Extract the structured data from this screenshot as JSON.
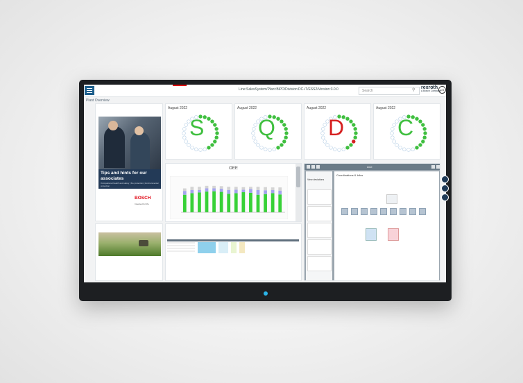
{
  "header": {
    "line_path": "Line:SalesSystem/Plant:BiPD/Division:DC-iT/ESS2/Version:3.0.0",
    "search_placeholder": "Search",
    "brand": "rexroth",
    "brand_sub": "A Bosch Company"
  },
  "breadcrumb": "Plant Overview",
  "kpi_cards": [
    {
      "date": "August 2022",
      "letter": "S",
      "color": "#3fbf3f"
    },
    {
      "date": "August 2022",
      "letter": "Q",
      "color": "#3fbf3f"
    },
    {
      "date": "August 2022",
      "letter": "D",
      "color": "#d62020"
    },
    {
      "date": "August 2022",
      "letter": "C",
      "color": "#3fbf3f"
    }
  ],
  "promo": {
    "headline_1": "Tips and hints for our",
    "headline_2": "associates",
    "sub": "Occupational health and safety | fire protection | Environmental protection",
    "brand": "BOSCH",
    "slogan": "Invented for life"
  },
  "oee": {
    "title": "OEE"
  },
  "deviations": {
    "tab": "Line",
    "title": "View deviations",
    "org_title": "Coordinations & Infos"
  },
  "chart_data": {
    "type": "bar",
    "title": "OEE",
    "categories": [
      "1",
      "2",
      "3",
      "4",
      "5",
      "6",
      "7",
      "8",
      "9",
      "10",
      "11",
      "12",
      "13",
      "14"
    ],
    "series": [
      {
        "name": "",
        "values": [
          55,
          60,
          62,
          65,
          66,
          64,
          58,
          60,
          63,
          61,
          55,
          57,
          60,
          56
        ]
      },
      {
        "name": "",
        "values": [
          12,
          10,
          8,
          10,
          9,
          10,
          12,
          11,
          8,
          12,
          15,
          12,
          10,
          12
        ]
      },
      {
        "name": "",
        "values": [
          8,
          10,
          10,
          8,
          8,
          8,
          10,
          9,
          8,
          7,
          10,
          10,
          8,
          10
        ]
      }
    ],
    "colors": [
      "#37d137",
      "#a4a4ee",
      "#d4d4d4"
    ],
    "ylim": [
      0,
      100
    ]
  }
}
